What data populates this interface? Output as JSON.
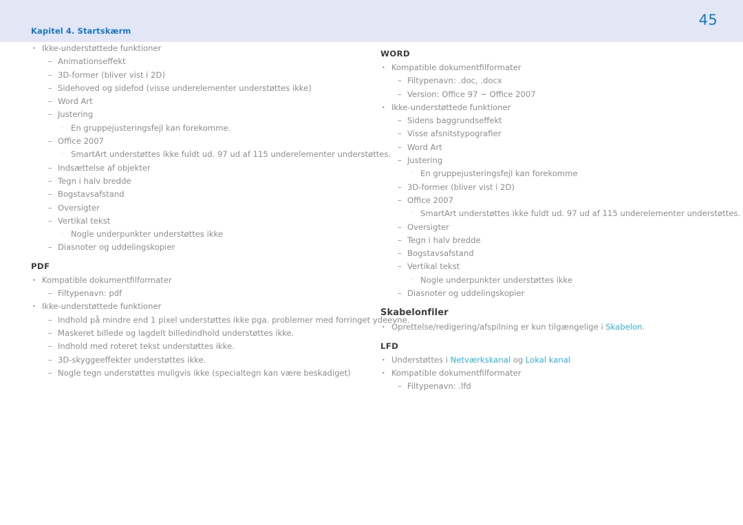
{
  "header": {
    "chapter_label": "Kapitel 4. Startskærm",
    "page_number": "45",
    "band_color": "#e3e7f5",
    "accent_color": "#1878c8"
  },
  "theme": {
    "body_text_color": "#8d8d8d",
    "heading_color": "#3d3d3d",
    "link_color": "#29b6e8",
    "page_background": "#ffffff"
  },
  "markers": {
    "level1": "•",
    "level2": "–",
    "level3": "·"
  },
  "columns": {
    "left": [
      {
        "type": "list",
        "items": [
          {
            "level": 1,
            "text": "Ikke-understøttede funktioner"
          },
          {
            "level": 2,
            "text": "Animationseffekt"
          },
          {
            "level": 2,
            "text": "3D-former (bliver vist i 2D)"
          },
          {
            "level": 2,
            "text": "Sidehoved og sidefod (visse underelementer understøttes ikke)"
          },
          {
            "level": 2,
            "text": "Word Art"
          },
          {
            "level": 2,
            "text": "Justering"
          },
          {
            "level": 3,
            "text": "En gruppejusteringsfejl kan forekomme."
          },
          {
            "level": 2,
            "text": "Office 2007"
          },
          {
            "level": 3,
            "text": "SmartArt understøttes ikke fuldt ud. 97 ud af 115 underelementer understøttes."
          },
          {
            "level": 2,
            "text": "Indsættelse af objekter"
          },
          {
            "level": 2,
            "text": "Tegn i halv bredde"
          },
          {
            "level": 2,
            "text": "Bogstavsafstand"
          },
          {
            "level": 2,
            "text": "Oversigter"
          },
          {
            "level": 2,
            "text": "Vertikal tekst"
          },
          {
            "level": 3,
            "text": "Nogle underpunkter understøttes ikke"
          },
          {
            "level": 2,
            "text": "Diasnoter og uddelingskopier"
          }
        ]
      },
      {
        "type": "section",
        "heading": "PDF",
        "heading_style": "caps",
        "items": [
          {
            "level": 1,
            "text": "Kompatible dokumentfilformater"
          },
          {
            "level": 2,
            "text": "Filtypenavn: pdf"
          },
          {
            "level": 1,
            "text": "Ikke-understøttede funktioner"
          },
          {
            "level": 2,
            "text": "Indhold på mindre end 1 pixel understøttes ikke pga. problemer med forringet ydeevne."
          },
          {
            "level": 2,
            "text": "Maskeret billede og lagdelt billedindhold understøttes ikke."
          },
          {
            "level": 2,
            "text": "Indhold med roteret tekst understøttes ikke."
          },
          {
            "level": 2,
            "text": "3D-skyggeeffekter understøttes ikke."
          },
          {
            "level": 2,
            "text": "Nogle tegn understøttes muligvis ikke (specialtegn kan være beskadiget)"
          }
        ]
      }
    ],
    "right": [
      {
        "type": "section",
        "heading": "WORD",
        "heading_style": "caps",
        "items": [
          {
            "level": 1,
            "text": "Kompatible dokumentfilformater"
          },
          {
            "level": 2,
            "text": "Filtypenavn: .doc, .docx"
          },
          {
            "level": 2,
            "text": "Version: Office 97 ~ Office 2007"
          },
          {
            "level": 1,
            "text": "Ikke-understøttede funktioner"
          },
          {
            "level": 2,
            "text": "Sidens baggrundseffekt"
          },
          {
            "level": 2,
            "text": "Visse afsnitstypografier"
          },
          {
            "level": 2,
            "text": "Word Art"
          },
          {
            "level": 2,
            "text": "Justering"
          },
          {
            "level": 3,
            "text": "En gruppejusteringsfejl kan forekomme"
          },
          {
            "level": 2,
            "text": "3D-former (bliver vist i 2D)"
          },
          {
            "level": 2,
            "text": "Office 2007"
          },
          {
            "level": 3,
            "text": "SmartArt understøttes ikke fuldt ud. 97 ud af 115 underelementer understøttes."
          },
          {
            "level": 2,
            "text": "Oversigter"
          },
          {
            "level": 2,
            "text": "Tegn i halv bredde"
          },
          {
            "level": 2,
            "text": "Bogstavsafstand"
          },
          {
            "level": 2,
            "text": "Vertikal tekst"
          },
          {
            "level": 3,
            "text": "Nogle underpunkter understøttes ikke"
          },
          {
            "level": 2,
            "text": "Diasnoter og uddelingskopier"
          }
        ]
      },
      {
        "type": "section",
        "heading": "Skabelonfiler",
        "heading_style": "title",
        "items": [
          {
            "level": 1,
            "parts": [
              {
                "text": "Oprettelse/redigering/afspilning er kun tilgængelige i ",
                "link": false
              },
              {
                "text": "Skabelon",
                "link": true
              },
              {
                "text": ".",
                "link": false
              }
            ]
          }
        ]
      },
      {
        "type": "section",
        "heading": "LFD",
        "heading_style": "caps",
        "items": [
          {
            "level": 1,
            "parts": [
              {
                "text": "Understøttes i ",
                "link": false
              },
              {
                "text": "Netværkskanal",
                "link": true
              },
              {
                "text": " og ",
                "link": false
              },
              {
                "text": "Lokal kanal",
                "link": true
              }
            ]
          },
          {
            "level": 1,
            "text": "Kompatible dokumentfilformater"
          },
          {
            "level": 2,
            "text": "Filtypenavn: .lfd"
          }
        ]
      }
    ]
  }
}
